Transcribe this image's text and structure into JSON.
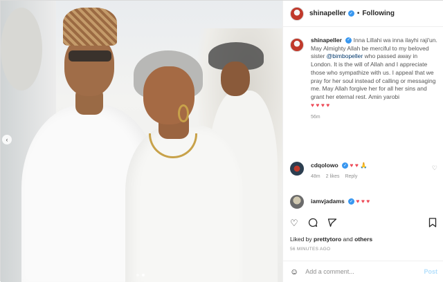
{
  "header": {
    "username": "shinapeller",
    "separator": "•",
    "follow_state": "Following"
  },
  "caption": {
    "username": "shinapeller",
    "text_before_mention": "Inna Lillahi wa inna ilayhi raji'un. May Almighty Allah be merciful to my beloved sister ",
    "mention": "@bimbopeller",
    "text_after_mention": " who passed away in London. It is the will of Allah and I appreciate those who sympathize with us. I appeal that we pray for her soul instead of calling or messaging me. May Allah forgive her for all her sins and grant her eternal rest. Amin yarobi",
    "hearts": "♥ ♥ ♥ ♥",
    "time_ago": "56m"
  },
  "comments": [
    {
      "username": "cdqolowo",
      "text": "♥ ♥ 🙏",
      "time": "48m",
      "likes": "2 likes",
      "reply": "Reply"
    },
    {
      "username": "iamvjadams",
      "text": "♥ ♥ ♥",
      "time": "",
      "likes": "",
      "reply": ""
    }
  ],
  "liked_by": {
    "prefix": "Liked by ",
    "user": "prettytoro",
    "suffix": " and ",
    "others": "others"
  },
  "timestamp": "56 MINUTES AGO",
  "add_comment": {
    "placeholder": "Add a comment...",
    "post_label": "Post"
  },
  "icons": {
    "nav_prev": "‹",
    "emoji": "☺",
    "like": "♡",
    "heart_small": "♡"
  },
  "colors": {
    "accent": "#3897f0",
    "heart": "#ed4956",
    "link": "#00376b",
    "post_disabled": "#b2dffc"
  }
}
